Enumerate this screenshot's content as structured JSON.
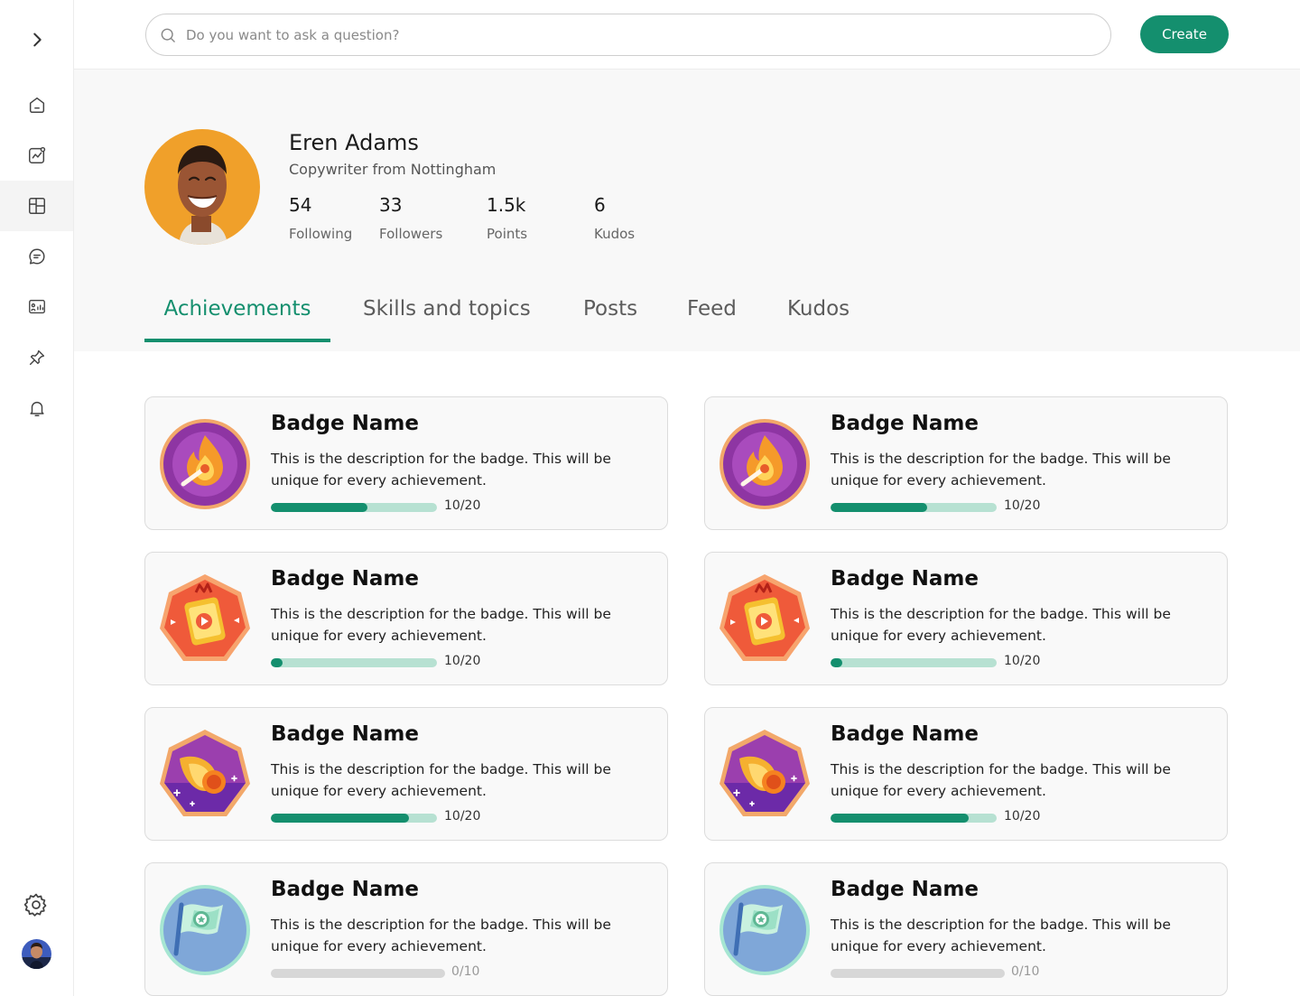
{
  "search": {
    "placeholder": "Do you want to ask a question?"
  },
  "header": {
    "create_label": "Create"
  },
  "sidebar": {
    "items": [
      {
        "name": "home-icon"
      },
      {
        "name": "analytics-icon"
      },
      {
        "name": "dashboard-icon",
        "active": true
      },
      {
        "name": "chat-icon"
      },
      {
        "name": "report-icon"
      },
      {
        "name": "pin-icon"
      },
      {
        "name": "bell-icon"
      }
    ]
  },
  "profile": {
    "name": "Eren Adams",
    "subtitle": "Copywriter from Nottingham",
    "stats": [
      {
        "value": "54",
        "label": "Following"
      },
      {
        "value": "33",
        "label": "Followers"
      },
      {
        "value": "1.5k",
        "label": "Points"
      },
      {
        "value": "6",
        "label": "Kudos"
      }
    ]
  },
  "tabs": [
    {
      "label": "Achievements",
      "active": true
    },
    {
      "label": "Skills and topics"
    },
    {
      "label": "Posts"
    },
    {
      "label": "Feed"
    },
    {
      "label": "Kudos"
    }
  ],
  "colors": {
    "accent": "#148f6e",
    "track": "#b7e1d2",
    "track_empty": "#d7d7d7"
  },
  "achievements": [
    {
      "title": "Badge Name",
      "description": "This is the description for the badge. This will be unique for every achievement.",
      "progress_text": "10/20",
      "fill": 0.58,
      "badge": "fire-badge-icon"
    },
    {
      "title": "Badge Name",
      "description": "This is the description for the badge. This will be unique for every achievement.",
      "progress_text": "10/20",
      "fill": 0.58,
      "badge": "fire-badge-icon"
    },
    {
      "title": "Badge Name",
      "description": "This is the description for the badge. This will be unique for every achievement.",
      "progress_text": "10/20",
      "fill": 0.07,
      "badge": "video-badge-icon"
    },
    {
      "title": "Badge Name",
      "description": "This is the description for the badge. This will be unique for every achievement.",
      "progress_text": "10/20",
      "fill": 0.07,
      "badge": "video-badge-icon"
    },
    {
      "title": "Badge Name",
      "description": "This is the description for the badge. This will be unique for every achievement.",
      "progress_text": "10/20",
      "fill": 0.83,
      "badge": "comet-badge-icon"
    },
    {
      "title": "Badge Name",
      "description": "This is the description for the badge. This will be unique for every achievement.",
      "progress_text": "10/20",
      "fill": 0.83,
      "badge": "comet-badge-icon"
    },
    {
      "title": "Badge Name",
      "description": "This is the description for the badge. This will be unique for every achievement.",
      "progress_text": "0/10",
      "fill": 0,
      "badge": "flag-badge-icon"
    },
    {
      "title": "Badge Name",
      "description": "This is the description for the badge. This will be unique for every achievement.",
      "progress_text": "0/10",
      "fill": 0,
      "badge": "flag-badge-icon"
    }
  ]
}
